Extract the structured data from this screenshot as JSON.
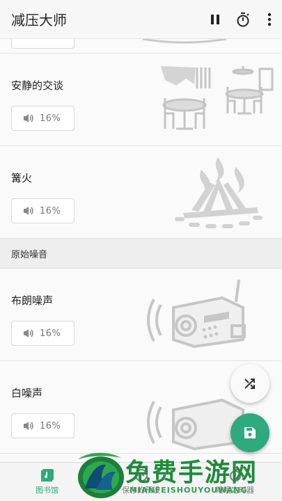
{
  "app": {
    "title": "减压大师"
  },
  "toolbar": {
    "pause_icon": "pause-icon",
    "timer_icon": "timer-icon",
    "more_icon": "more-vert-icon"
  },
  "sounds": [
    {
      "name": "安静的交谈",
      "volume": "16%",
      "art": "cafe-tables"
    },
    {
      "name": "篝火",
      "volume": "16%",
      "art": "campfire"
    },
    {
      "name": "布朗噪声",
      "volume": "16%",
      "art": "radio"
    },
    {
      "name": "白噪声",
      "volume": "16%",
      "art": "radio"
    }
  ],
  "section": {
    "title": "原始噪音"
  },
  "fabs": {
    "shuffle_icon": "shuffle-icon",
    "save_icon": "save-icon",
    "accent": "#2eaa7c"
  },
  "bottom_nav": {
    "tabs": [
      {
        "label": "图书馆",
        "icon": "library-icon",
        "active": true
      },
      {
        "label": "保存的预设",
        "icon": "saved-presets-icon",
        "active": false
      },
      {
        "label": "睡眠定时器",
        "icon": "sleep-timer-icon",
        "active": false
      }
    ]
  },
  "watermark": {
    "title": "免费手游网",
    "subtitle": "MIANFEISHOUYOUWANG"
  }
}
